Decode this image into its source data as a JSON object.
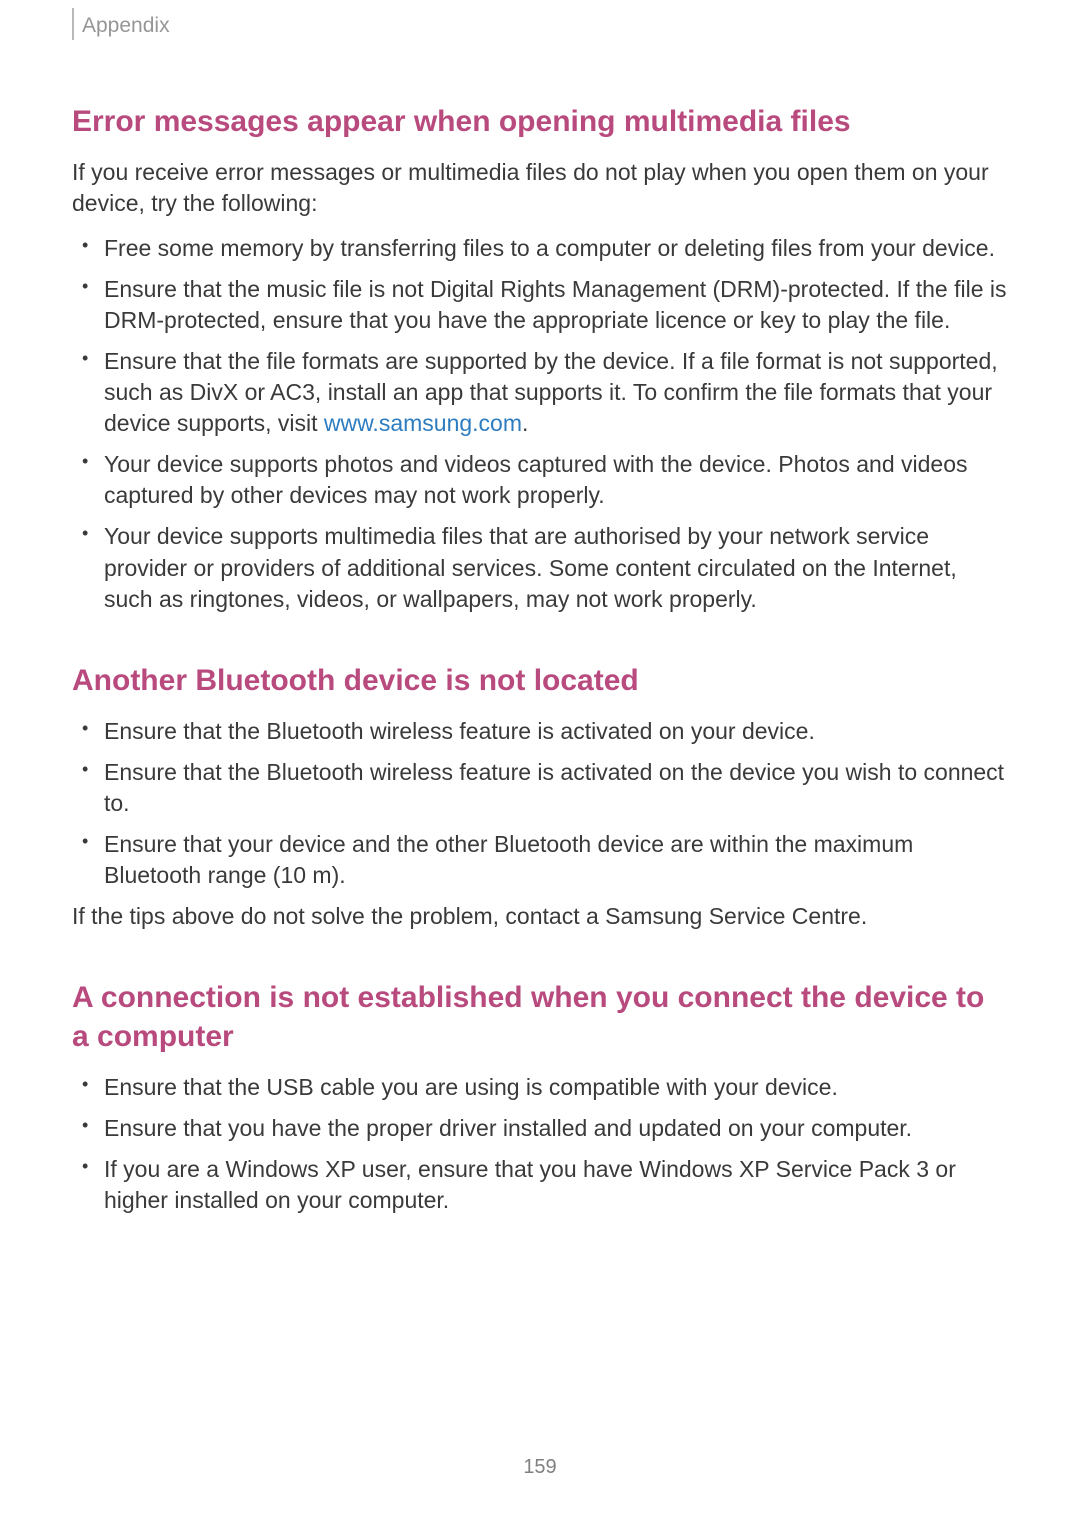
{
  "header": {
    "section_label": "Appendix"
  },
  "sections": [
    {
      "heading": "Error messages appear when opening multimedia files",
      "intro": "If you receive error messages or multimedia files do not play when you open them on your device, try the following:",
      "bullets": [
        {
          "text": "Free some memory by transferring files to a computer or deleting files from your device."
        },
        {
          "text": "Ensure that the music file is not Digital Rights Management (DRM)-protected. If the file is DRM-protected, ensure that you have the appropriate licence or key to play the file."
        },
        {
          "prefix": "Ensure that the file formats are supported by the device. If a file format is not supported, such as DivX or AC3, install an app that supports it. To confirm the file formats that your device supports, visit ",
          "link": "www.samsung.com",
          "suffix": "."
        },
        {
          "text": "Your device supports photos and videos captured with the device. Photos and videos captured by other devices may not work properly."
        },
        {
          "text": "Your device supports multimedia files that are authorised by your network service provider or providers of additional services. Some content circulated on the Internet, such as ringtones, videos, or wallpapers, may not work properly."
        }
      ],
      "outro": ""
    },
    {
      "heading": "Another Bluetooth device is not located",
      "intro": "",
      "bullets": [
        {
          "text": "Ensure that the Bluetooth wireless feature is activated on your device."
        },
        {
          "text": "Ensure that the Bluetooth wireless feature is activated on the device you wish to connect to."
        },
        {
          "text": "Ensure that your device and the other Bluetooth device are within the maximum Bluetooth range (10 m)."
        }
      ],
      "outro": "If the tips above do not solve the problem, contact a Samsung Service Centre."
    },
    {
      "heading": "A connection is not established when you connect the device to a computer",
      "intro": "",
      "bullets": [
        {
          "text": "Ensure that the USB cable you are using is compatible with your device."
        },
        {
          "text": "Ensure that you have the proper driver installed and updated on your computer."
        },
        {
          "text": "If you are a Windows XP user, ensure that you have Windows XP Service Pack 3 or higher installed on your computer."
        }
      ],
      "outro": ""
    }
  ],
  "page_number": "159"
}
